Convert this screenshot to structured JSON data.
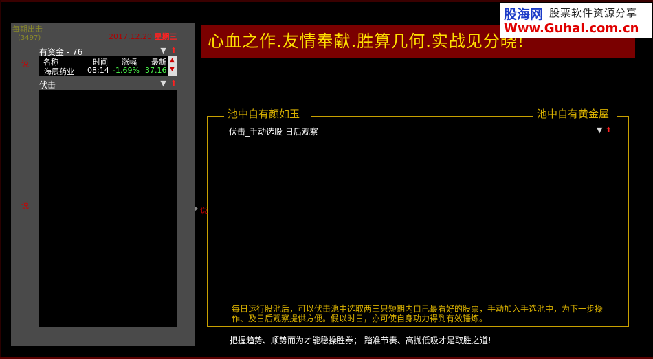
{
  "colors": {
    "panel": "#4a4a4a",
    "banner_bg": "#7a0000",
    "banner_text": "#ffe000",
    "gold": "#c8a000",
    "up": "#ff2020",
    "down": "#4cff4c"
  },
  "side": {
    "title": "每期出击",
    "sub": "(3497)",
    "date": "2017.12.20",
    "date_suffix": "星期三",
    "mark1": "说",
    "mark2": "说"
  },
  "list1": {
    "title": "有资金 - 76",
    "columns": [
      "名称",
      "时间",
      "涨幅",
      "最新"
    ],
    "rows": [
      {
        "name": "海辰药业",
        "time": "08:14",
        "change": "-1.69%",
        "price": "37.16"
      }
    ]
  },
  "list2": {
    "title": "伏击"
  },
  "banner": {
    "text": "心血之作.友情奉献.胜算几何.实战见分晓!"
  },
  "logo": {
    "brand": "股海网",
    "tag": "股票软件资源分享",
    "url": "Www.Guhai.com.cn"
  },
  "pool": {
    "left_title": "池中自有颜如玉",
    "right_title": "池中自有黄金屋",
    "watch_title": "伏击_手动选股 日后观察",
    "description": "每日运行股池后，可以伏击池中选取两三只短期内自己最看好的股票，手动加入手选池中，为下一步操作、及日后观察提供方便。假以时日，亦可使自身功力得到有效锤炼。",
    "mid_mark": "说"
  },
  "footer": {
    "note": "把握趋势、顺势而为才能稳操胜券； 踏准节奏、高抛低吸才是取胜之道!"
  },
  "icons": {
    "sort_down": "triangle-down-icon",
    "sort_up": "red-up-arrow-icon"
  }
}
